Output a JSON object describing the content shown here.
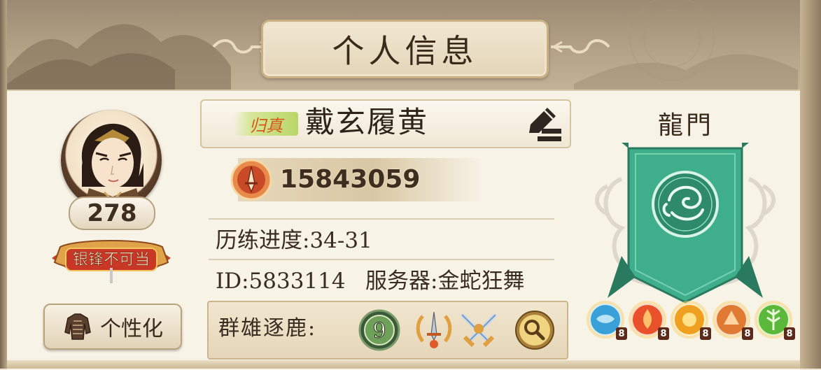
{
  "window": {
    "title": "个人信息"
  },
  "player": {
    "level": "278",
    "rank_tag": "归真",
    "name": "戴玄履黄",
    "power": "15843059",
    "progress_label": "历练进度:34-31",
    "id_label": "ID:5833114",
    "server_label": "服务器:金蛇狂舞",
    "badge_text": "银锋不可当"
  },
  "buttons": {
    "personalize": "个性化"
  },
  "arena": {
    "label": "群雄逐鹿:",
    "tier": "9",
    "icons": [
      "tier-9-medal-icon",
      "crossed-swords-laurel-icon",
      "crossed-blades-icon",
      "magnifier-icon"
    ]
  },
  "guild": {
    "title": "龍門",
    "banner_color": "#3fae8a"
  },
  "elements": [
    {
      "name": "water",
      "color": "#3aa0d8",
      "level": "8"
    },
    {
      "name": "fire",
      "color": "#e8512a",
      "level": "8"
    },
    {
      "name": "sun",
      "color": "#f0a020",
      "level": "8"
    },
    {
      "name": "ember",
      "color": "#e07a32",
      "level": "8"
    },
    {
      "name": "wood",
      "color": "#5cb83a",
      "level": "8"
    }
  ]
}
